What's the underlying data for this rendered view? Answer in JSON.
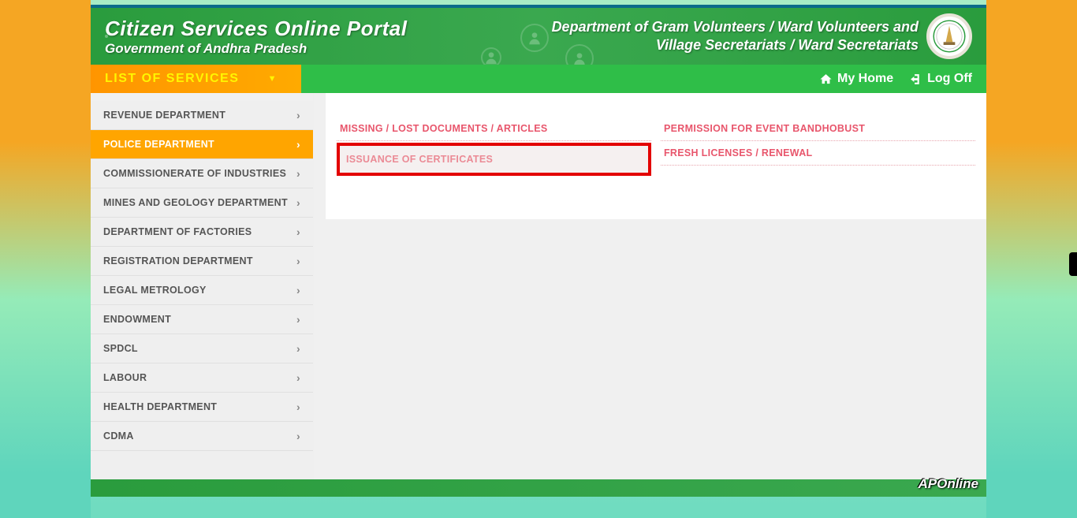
{
  "header": {
    "title": "Citizen Services Online Portal",
    "subtitle": "Government of Andhra Pradesh",
    "dept_line1": "Department of Gram Volunteers / Ward Volunteers and",
    "dept_line2": "Village Secretariats / Ward Secretariats"
  },
  "menubar": {
    "list_label": "LIST OF SERVICES",
    "my_home": "My Home",
    "log_off": "Log Off"
  },
  "sidebar": {
    "items": [
      {
        "label": "REVENUE DEPARTMENT",
        "active": false
      },
      {
        "label": "POLICE DEPARTMENT",
        "active": true
      },
      {
        "label": "COMMISSIONERATE OF INDUSTRIES",
        "active": false
      },
      {
        "label": "MINES AND GEOLOGY DEPARTMENT",
        "active": false
      },
      {
        "label": "DEPARTMENT OF FACTORIES",
        "active": false
      },
      {
        "label": "REGISTRATION DEPARTMENT",
        "active": false
      },
      {
        "label": "LEGAL METROLOGY",
        "active": false
      },
      {
        "label": "ENDOWMENT",
        "active": false
      },
      {
        "label": "SPDCL",
        "active": false
      },
      {
        "label": "LABOUR",
        "active": false
      },
      {
        "label": "HEALTH DEPARTMENT",
        "active": false
      },
      {
        "label": "CDMA",
        "active": false
      }
    ]
  },
  "content": {
    "col1": [
      {
        "label": "MISSING / LOST DOCUMENTS / ARTICLES",
        "highlighted": false
      },
      {
        "label": "ISSUANCE OF CERTIFICATES",
        "highlighted": true
      }
    ],
    "col2": [
      {
        "label": "PERMISSION FOR EVENT BANDHOBUST",
        "highlighted": false
      },
      {
        "label": "FRESH LICENSES / RENEWAL",
        "highlighted": false
      }
    ]
  },
  "footer": {
    "logo": "APOnline"
  }
}
